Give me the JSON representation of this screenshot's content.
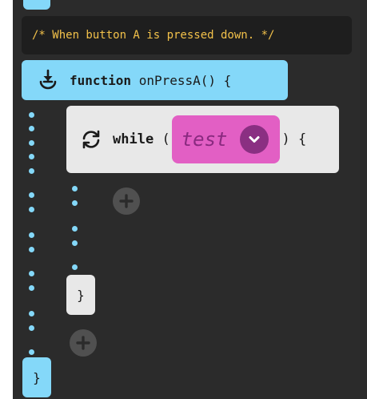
{
  "comment": {
    "text": "/* When button A is pressed down. */",
    "color": "#f2c14a"
  },
  "function_block": {
    "keyword": "function",
    "name": "onPressA() {",
    "icon": "press-download-icon",
    "color": "#84d8f9"
  },
  "while_block": {
    "keyword": "while",
    "open_paren": "(",
    "close": ") {",
    "icon": "loop-refresh-icon",
    "color": "#e8e8e8",
    "condition": {
      "label": "test",
      "icon": "chevron-down-icon",
      "color": "#e25fc4"
    }
  },
  "while_close": "}",
  "function_close": "}",
  "add_icon": "plus-icon"
}
